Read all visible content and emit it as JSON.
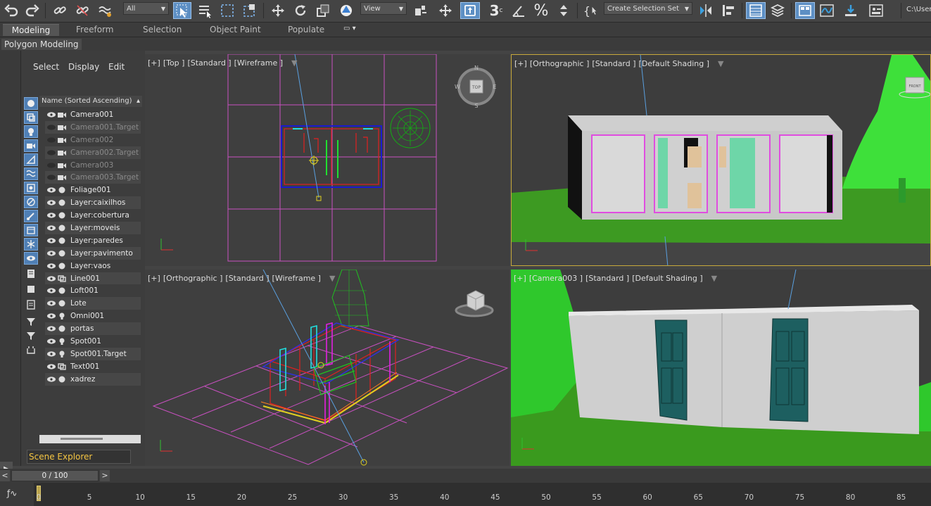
{
  "toolbar": {
    "filter_value": "All",
    "view_value": "View",
    "selection_set_value": "Create Selection Set",
    "path_text": "C:\\User"
  },
  "ribbon": {
    "tabs": [
      "Modeling",
      "Freeform",
      "Selection",
      "Object Paint",
      "Populate"
    ],
    "active": "Modeling",
    "panel_label": "Polygon Modeling"
  },
  "scene_explorer": {
    "menu": [
      "Select",
      "Display",
      "Edit"
    ],
    "column_header": "Name (Sorted Ascending)",
    "footer": "Scene Explorer",
    "items": [
      {
        "name": "Camera001",
        "type": "camera",
        "visible": true
      },
      {
        "name": "Camera001.Target",
        "type": "camera",
        "visible": false
      },
      {
        "name": "Camera002",
        "type": "camera",
        "visible": false
      },
      {
        "name": "Camera002.Target",
        "type": "camera",
        "visible": false
      },
      {
        "name": "Camera003",
        "type": "camera",
        "visible": false
      },
      {
        "name": "Camera003.Target",
        "type": "camera",
        "visible": false
      },
      {
        "name": "Foliage001",
        "type": "geometry",
        "visible": true
      },
      {
        "name": "Layer:caixilhos",
        "type": "geometry",
        "visible": true
      },
      {
        "name": "Layer:cobertura",
        "type": "geometry",
        "visible": true
      },
      {
        "name": "Layer:moveis",
        "type": "geometry",
        "visible": true
      },
      {
        "name": "Layer:paredes",
        "type": "geometry",
        "visible": true
      },
      {
        "name": "Layer:pavimento",
        "type": "geometry",
        "visible": true
      },
      {
        "name": "Layer:vaos",
        "type": "geometry",
        "visible": true
      },
      {
        "name": "Line001",
        "type": "shape",
        "visible": true
      },
      {
        "name": "Loft001",
        "type": "geometry",
        "visible": true
      },
      {
        "name": "Lote",
        "type": "geometry",
        "visible": true
      },
      {
        "name": "Omni001",
        "type": "light",
        "visible": true
      },
      {
        "name": "portas",
        "type": "geometry",
        "visible": true
      },
      {
        "name": "Spot001",
        "type": "light",
        "visible": true
      },
      {
        "name": "Spot001.Target",
        "type": "light",
        "visible": true
      },
      {
        "name": "Text001",
        "type": "shape",
        "visible": true
      },
      {
        "name": "xadrez",
        "type": "geometry",
        "visible": true
      }
    ]
  },
  "viewports": {
    "top": {
      "parts": [
        "[+]",
        "[Top ]",
        "[Standard ]",
        "[Wireframe ]"
      ]
    },
    "ortho_shaded": {
      "parts": [
        "[+]",
        "[Orthographic ]",
        "[Standard ]",
        "[Default Shading ]"
      ]
    },
    "ortho_wire": {
      "parts": [
        "[+]",
        "[Orthographic ]",
        "[Standard ]",
        "[Wireframe ]"
      ]
    },
    "camera": {
      "parts": [
        "[+]",
        "[Camera003 ]",
        "[Standard ]",
        "[Default Shading ]"
      ]
    },
    "viewcube_top_label": "TOP",
    "viewcube_front_label": "FRONT",
    "compass": {
      "n": "N",
      "s": "S",
      "e": "E",
      "w": "W"
    }
  },
  "timeline": {
    "frame_display": "0 / 100",
    "prev": "<",
    "next": ">",
    "ticks": [
      "0",
      "5",
      "10",
      "15",
      "20",
      "25",
      "30",
      "35",
      "40",
      "45",
      "50",
      "55",
      "60",
      "65",
      "70",
      "75",
      "80",
      "85"
    ]
  },
  "colors": {
    "active_tool": "#5d8fc4",
    "active_viewport_border": "#c7a93b",
    "grid_magenta": "#c850c0",
    "grass": "#3a9a1e",
    "door_teal": "#1d5f60"
  }
}
